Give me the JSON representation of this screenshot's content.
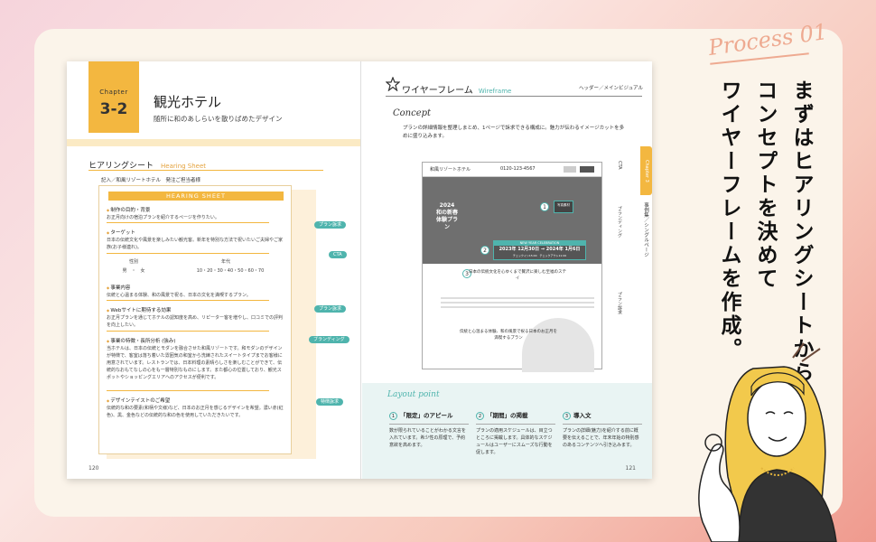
{
  "left_page": {
    "chapter_word": "Chapter",
    "chapter_number": "3-2",
    "title": "観光ホテル",
    "subtitle": "随所に和のあしらいを散りばめたデザイン",
    "section_title": "ヒアリングシート",
    "section_en": "Hearing Sheet",
    "meta": "記入／和風リゾートホテル　発注ご担当者様",
    "page_number": "120",
    "sheet": {
      "header": "HEARING SHEET",
      "items": [
        {
          "q": "制作の目的・背景",
          "a": "お正月向けの宿泊プランを紹介するページを作りたい。"
        },
        {
          "q": "ターゲット",
          "a": "日本の伝統文化や風景を楽しみたい観光客。新年を特別な方法で祝いたいご夫婦やご家族(お子様連れ)。"
        },
        {
          "q": "事業内容",
          "a": "伝統と心温まる体験、和の風景で祝る、日本の文化を満喫するプラン。"
        },
        {
          "q": "Webサイトに期待する効果",
          "a": "お正月プランを通じてホテルの認知度を高め、リピーター客を増やし、口コミでの評判を向上したい。"
        },
        {
          "q": "事業の特徴・長所分析 (強み)",
          "a": "当ホテルは、日本の伝統とモダンを融合させた和風リゾートです。和モダンのデザインが特徴で、客室は落ち着いた雰囲気の和室から洗練されたスイートタイプまでお客様に用意されています。レストランでは、日本料理の素晴らしさを楽しむことができて、伝統的なおもてなしの心をも一層特別なものにします。また都心の位置しており、観光スポットやショッピングエリアへのアクセスが便利です。"
        },
        {
          "q": "デザインテイストのご希望",
          "a": "伝統的な和の要素(和柄や文様)など、日本のお正月を感じるデザインを希望。濃い赤(紅色)、黒、金色などの伝統的な和の色を使用していただきたいです。"
        }
      ],
      "gender_label": "性別",
      "gender_value": "男　・　女",
      "age_label": "年代",
      "age_value": "10・20・30・40・50・60・70",
      "callouts": [
        "プラン訴求",
        "CTA",
        "プラン訴求",
        "ブランディング",
        "特徴訴求"
      ]
    }
  },
  "right_page": {
    "title": "ワイヤーフレーム",
    "title_en": "Wireframe",
    "header_note": "ヘッダー／メインビジュアル",
    "concept_label": "Concept",
    "concept_text": "プランの詳細情報を整理しまとめ、1ページで訴求できる構成に。魅力が伝わるイメージカットを多めに盛り込みます。",
    "page_number": "121",
    "wireframe": {
      "brand": "和風リゾートホテル",
      "tel": "0120-123-4567",
      "hero_vertical": "2024 和の新春体験プラン",
      "box1": "写真素材",
      "event_title": "NEW YEAR CELEBRATION",
      "event_dates": "2023年 12月30日 → 2024年 1月6日",
      "event_sub": "チェックイン15:00　チェックアウト11:00",
      "step3_text": "日本の伝統文化を心ゆくまで贅沢に楽しむ至福のステイ",
      "tagline": "伝統と心温まる体験、和の風景で祝る日本のお正月を満喫するプラン",
      "side_cta": "CTA",
      "side_brand": "ブランディング",
      "side_plan": "プラン訴求"
    },
    "layout_point": {
      "label": "Layout point",
      "cards": [
        {
          "num": "1",
          "title": "「限定」のアピール",
          "text": "数が限られていることがわかる文言を入れています。希少性の原理で、予約意欲を高めます。"
        },
        {
          "num": "2",
          "title": "「期間」の掲載",
          "text": "プランの適用スケジュールは、目立つところに掲載します。具体的なスケジュールはユーザーにスムーズな行動を促します。"
        },
        {
          "num": "3",
          "title": "導入文",
          "text": "プランの詳細(魅力)を紹介する前に概要を伝えることで、年末年始の特別感のあるコンテンツへ引き込みます。"
        }
      ]
    }
  },
  "chapter_tab": "Chapter 3",
  "chapter_tab_sub": "事例集／シングルページ",
  "process_label": "Process 01",
  "headline_lines": [
    "まずはヒアリングシートから",
    "コンセプトを決めて",
    "ワイヤーフレームを作成。"
  ],
  "colors": {
    "accent_yellow": "#f3b740",
    "accent_teal": "#4fb4ad",
    "accent_peach": "#eeaa91"
  }
}
